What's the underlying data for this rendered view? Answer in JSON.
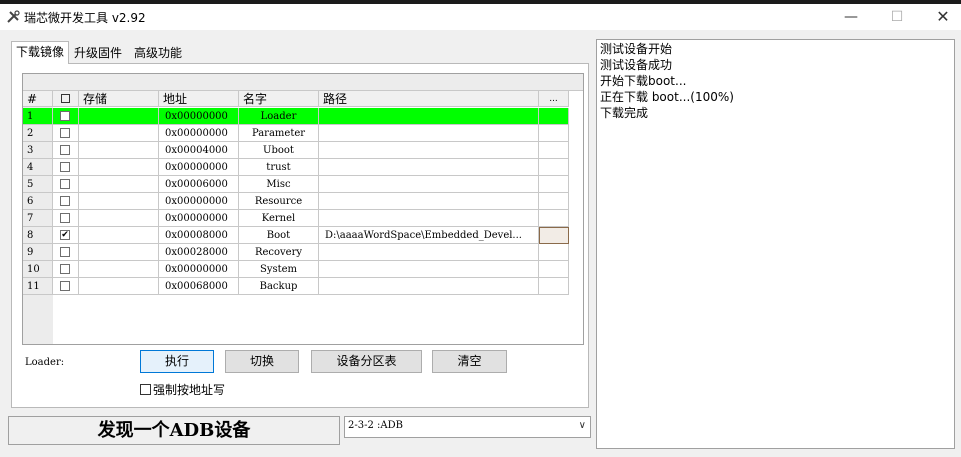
{
  "window": {
    "title": "瑞芯微开发工具 v2.92",
    "minimize_glyph": "—",
    "maximize_glyph": "☐",
    "close_glyph": "✕"
  },
  "tabs": [
    {
      "label": "下载镜像",
      "active": true
    },
    {
      "label": "升级固件",
      "active": false
    },
    {
      "label": "高级功能",
      "active": false
    }
  ],
  "table": {
    "columns": [
      "#",
      "",
      "存储",
      "地址",
      "名字",
      "路径",
      "..."
    ],
    "rows": [
      {
        "num": "1",
        "checked": false,
        "store": "",
        "addr": "0x00000000",
        "name": "Loader",
        "path": "",
        "highlight": true
      },
      {
        "num": "2",
        "checked": false,
        "store": "",
        "addr": "0x00000000",
        "name": "Parameter",
        "path": "",
        "highlight": false
      },
      {
        "num": "3",
        "checked": false,
        "store": "",
        "addr": "0x00004000",
        "name": "Uboot",
        "path": "",
        "highlight": false
      },
      {
        "num": "4",
        "checked": false,
        "store": "",
        "addr": "0x00000000",
        "name": "trust",
        "path": "",
        "highlight": false
      },
      {
        "num": "5",
        "checked": false,
        "store": "",
        "addr": "0x00006000",
        "name": "Misc",
        "path": "",
        "highlight": false
      },
      {
        "num": "6",
        "checked": false,
        "store": "",
        "addr": "0x00000000",
        "name": "Resource",
        "path": "",
        "highlight": false
      },
      {
        "num": "7",
        "checked": false,
        "store": "",
        "addr": "0x00000000",
        "name": "Kernel",
        "path": "",
        "highlight": false
      },
      {
        "num": "8",
        "checked": true,
        "store": "",
        "addr": "0x00008000",
        "name": "Boot",
        "path": "D:\\aaaaWordSpace\\Embedded_Devel...",
        "highlight": false
      },
      {
        "num": "9",
        "checked": false,
        "store": "",
        "addr": "0x00028000",
        "name": "Recovery",
        "path": "",
        "highlight": false
      },
      {
        "num": "10",
        "checked": false,
        "store": "",
        "addr": "0x00000000",
        "name": "System",
        "path": "",
        "highlight": false
      },
      {
        "num": "11",
        "checked": false,
        "store": "",
        "addr": "0x00068000",
        "name": "Backup",
        "path": "",
        "highlight": false
      }
    ]
  },
  "loader_label": "Loader:",
  "buttons": {
    "run": "执行",
    "switch": "切换",
    "partition": "设备分区表",
    "clear": "清空"
  },
  "force_address_label": "强制按地址写",
  "status_text": "发现一个ADB设备",
  "device_select": "2-3-2 :ADB",
  "log_lines": [
    "测试设备开始",
    "测试设备成功",
    "开始下载boot...",
    "正在下载 boot...(100%)",
    "下载完成"
  ],
  "colors": {
    "highlight_row": "#00ff00"
  }
}
